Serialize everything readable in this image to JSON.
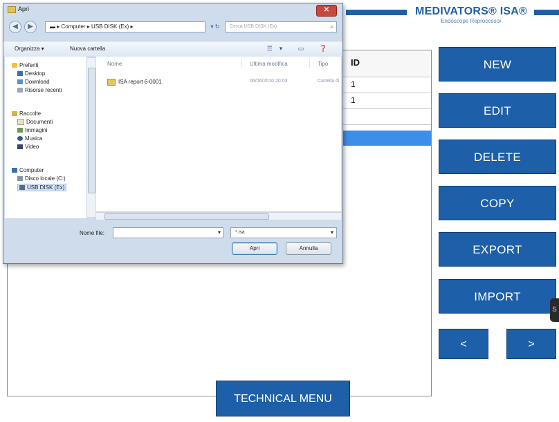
{
  "app": {
    "brand_name": "MEDIVATORS® ISA®",
    "brand_sub": "Endoscope Reprocessor",
    "colors": {
      "primary": "#1d5fa8",
      "selected_row": "#3b8fe8"
    },
    "list": {
      "id_header": "ID",
      "rows": [
        {
          "value": "1"
        },
        {
          "value": "1"
        },
        {
          "value": ""
        }
      ]
    },
    "buttons": {
      "new": "NEW",
      "edit": "EDIT",
      "delete": "DELETE",
      "copy": "COPY",
      "export": "EXPORT",
      "import": "IMPORT",
      "prev": "<",
      "next": ">",
      "technical_menu": "TECHNICAL MENU"
    }
  },
  "dialog": {
    "title": "Apri",
    "address_path": "▬ ▸ Computer ▸ USB DISK (Ex) ▸",
    "search_placeholder": "Cerca USB DISK (Ex)",
    "toolbar": {
      "organize": "Organizza ▾",
      "new_folder": "Nuova cartella"
    },
    "nav": {
      "favorites": "Preferiti",
      "desktop": "Desktop",
      "download": "Download",
      "recent": "Risorse recenti",
      "libraries": "Raccolte",
      "documents": "Documenti",
      "images": "Immagini",
      "music": "Musica",
      "video": "Video",
      "computer": "Computer",
      "local_disk": "Disco locale (C:)",
      "usb": "USB DISK (Ex)"
    },
    "columns": {
      "name": "Nome",
      "modified": "Ultima modifica",
      "type": "Tipo"
    },
    "files": [
      {
        "name": "ISA report 6-0001",
        "modified": "06/06/2010 20:03",
        "type": "Cartella di"
      }
    ],
    "file_name_label": "Nome file:",
    "file_name_value": "",
    "file_type": "*.isa",
    "open_button": "Apri",
    "cancel_button": "Annulla",
    "icons": {
      "close": "close-icon",
      "back": "back-arrow-icon",
      "forward": "forward-arrow-icon",
      "search": "search-icon",
      "folder": "folder-icon"
    }
  }
}
